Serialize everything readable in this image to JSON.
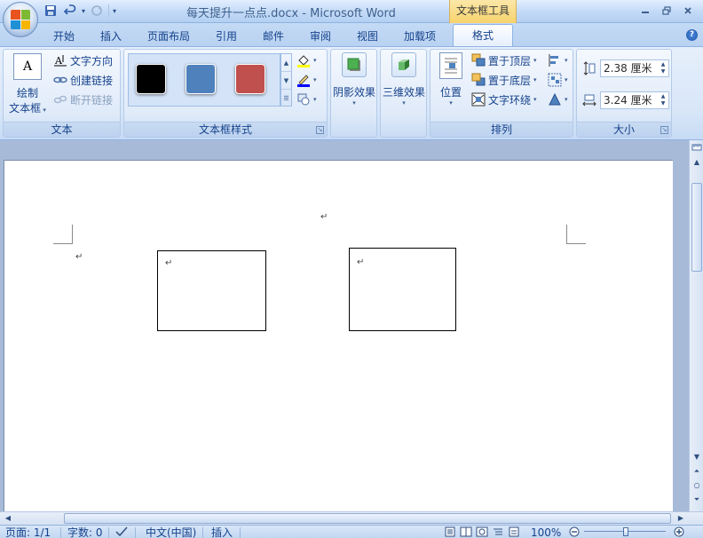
{
  "window": {
    "title": "每天提升一点点.docx - Microsoft Word",
    "context_tab_title": "文本框工具"
  },
  "tabs": [
    {
      "label": "开始"
    },
    {
      "label": "插入"
    },
    {
      "label": "页面布局"
    },
    {
      "label": "引用"
    },
    {
      "label": "邮件"
    },
    {
      "label": "审阅"
    },
    {
      "label": "视图"
    },
    {
      "label": "加载项"
    },
    {
      "label": "格式",
      "active": true
    }
  ],
  "ribbon": {
    "text_group": {
      "label": "文本",
      "draw_textbox_line1": "绘制",
      "draw_textbox_line2": "文本框",
      "text_direction": "文字方向",
      "create_link": "创建链接",
      "break_link": "断开链接"
    },
    "styles_group": {
      "label": "文本框样式",
      "swatches": [
        {
          "color": "#000000"
        },
        {
          "color": "#4f81bd"
        },
        {
          "color": "#c0504d"
        }
      ]
    },
    "shadow_group": {
      "label": "阴影效果"
    },
    "threed_group": {
      "label": "三维效果"
    },
    "arrange_group": {
      "label": "排列",
      "position": "位置",
      "bring_front": "置于顶层",
      "send_back": "置于底层",
      "text_wrap": "文字环绕"
    },
    "size_group": {
      "label": "大小",
      "height": "2.38 厘米",
      "width": "3.24 厘米"
    }
  },
  "document": {
    "paragraph_mark": "↵"
  },
  "statusbar": {
    "page": "页面: 1/1",
    "words": "字数: 0",
    "language": "中文(中国)",
    "mode": "插入",
    "zoom": "100%"
  }
}
